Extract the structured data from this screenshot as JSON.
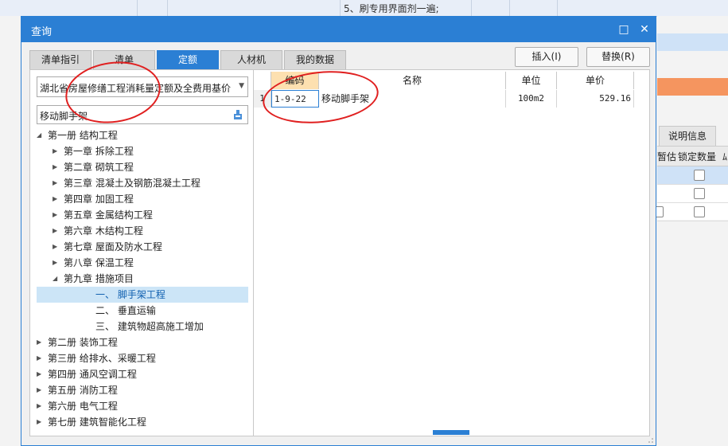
{
  "background": {
    "top_text": "5、刷专用界面剂一遍;",
    "right_tab": "说明信息",
    "right_cols": [
      "暂估",
      "锁定数量",
      "ﾑ"
    ]
  },
  "dialog": {
    "title": "查询",
    "restore_glyph": "□",
    "close_glyph": "✕",
    "tabs": [
      "清单指引",
      "清单",
      "定额",
      "人材机",
      "我的数据"
    ],
    "active_tab": "定额",
    "insert_label": "插入(I)",
    "replace_label": "替换(R)",
    "combo_value": "湖北省房屋修缮工程消耗量定额及全费用基价表",
    "search_value": "移动脚手架",
    "tree": [
      {
        "label": "第一册 结构工程",
        "level": 0,
        "expanded": true
      },
      {
        "label": "第一章 拆除工程",
        "level": 1,
        "expanded": false
      },
      {
        "label": "第二章 砌筑工程",
        "level": 1,
        "expanded": false
      },
      {
        "label": "第三章 混凝土及钢筋混凝土工程",
        "level": 1,
        "expanded": false
      },
      {
        "label": "第四章 加固工程",
        "level": 1,
        "expanded": false
      },
      {
        "label": "第五章 金属结构工程",
        "level": 1,
        "expanded": false
      },
      {
        "label": "第六章 木结构工程",
        "level": 1,
        "expanded": false
      },
      {
        "label": "第七章 屋面及防水工程",
        "level": 1,
        "expanded": false
      },
      {
        "label": "第八章 保温工程",
        "level": 1,
        "expanded": false
      },
      {
        "label": "第九章 措施项目",
        "level": 1,
        "expanded": true
      },
      {
        "label": "一、 脚手架工程",
        "level": 2,
        "selected": true
      },
      {
        "label": "二、 垂直运输",
        "level": 2
      },
      {
        "label": "三、 建筑物超高施工增加",
        "level": 2
      },
      {
        "label": "第二册 装饰工程",
        "level": 0,
        "expanded": false
      },
      {
        "label": "第三册 给排水、采暖工程",
        "level": 0,
        "expanded": false
      },
      {
        "label": "第四册 通风空调工程",
        "level": 0,
        "expanded": false
      },
      {
        "label": "第五册 消防工程",
        "level": 0,
        "expanded": false
      },
      {
        "label": "第六册 电气工程",
        "level": 0,
        "expanded": false
      },
      {
        "label": "第七册 建筑智能化工程",
        "level": 0,
        "expanded": false
      }
    ],
    "grid": {
      "headers": [
        "编码",
        "名称",
        "单位",
        "单价"
      ],
      "rows": [
        {
          "index": "1",
          "code": "1-9-22",
          "name": "移动脚手架",
          "unit": "100m2",
          "price": "529.16"
        }
      ]
    }
  },
  "colors": {
    "accent": "#2b7fd4",
    "highlight": "#e02020"
  }
}
